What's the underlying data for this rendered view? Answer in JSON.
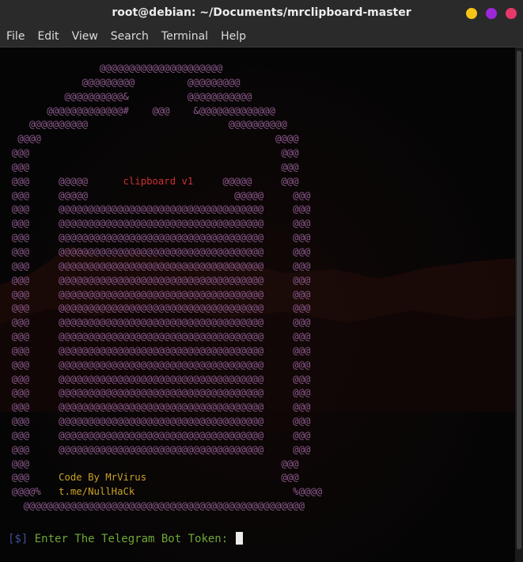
{
  "window": {
    "title": "root@debian: ~/Documents/mrclipboard-master",
    "buttons": [
      {
        "name": "minimize",
        "color": "#f5c518"
      },
      {
        "name": "maximize",
        "color": "#9c27d9"
      },
      {
        "name": "close",
        "color": "#e8386a"
      }
    ]
  },
  "menu": {
    "items": [
      "File",
      "Edit",
      "View",
      "Search",
      "Terminal",
      "Help"
    ]
  },
  "colors": {
    "art": "#8c5a8c",
    "accent_red": "#cc3030",
    "credit_yellow": "#c9a227",
    "prompt_blue": "#3d4e9b",
    "prompt_green": "#6ea838"
  },
  "terminal": {
    "art_lines": [
      "                 @@@@@@@@@@@@@@@@@@@@@",
      "              @@@@@@@@@         @@@@@@@@@",
      "           @@@@@@@@@@&          @@@@@@@@@@@",
      "        @@@@@@@@@@@@@#    @@@    &@@@@@@@@@@@@@",
      "     @@@@@@@@@@                        @@@@@@@@@@",
      "   @@@@                                        @@@@",
      "  @@@                                           @@@",
      "  @@@                                           @@@"
    ],
    "header_left": "  @@@     @@@@@      ",
    "header_title": "clipboard v1",
    "header_right": "     @@@@@     @@@",
    "art_line_after_header": "  @@@     @@@@@                         @@@@@     @@@",
    "body_line": "  @@@     @@@@@@@@@@@@@@@@@@@@@@@@@@@@@@@@@@@     @@@",
    "body_line_count": 18,
    "art_line_before_credits": "  @@@                                           @@@",
    "credit_line_1_left": "  @@@     ",
    "credit_line_1_text": "Code By MrVirus",
    "credit_line_1_right": "                       @@@",
    "credit_line_2_left": "  @@@@%   ",
    "credit_line_2_text": "t.me/NullHaCk",
    "credit_line_2_right": "                           %@@@@",
    "art_last_line": "    @@@@@@@@@@@@@@@@@@@@@@@@@@@@@@@@@@@@@@@@@@@@@@@@",
    "prompt_symbol": "[$]",
    "prompt_text": " Enter The Telegram Bot Token: "
  }
}
